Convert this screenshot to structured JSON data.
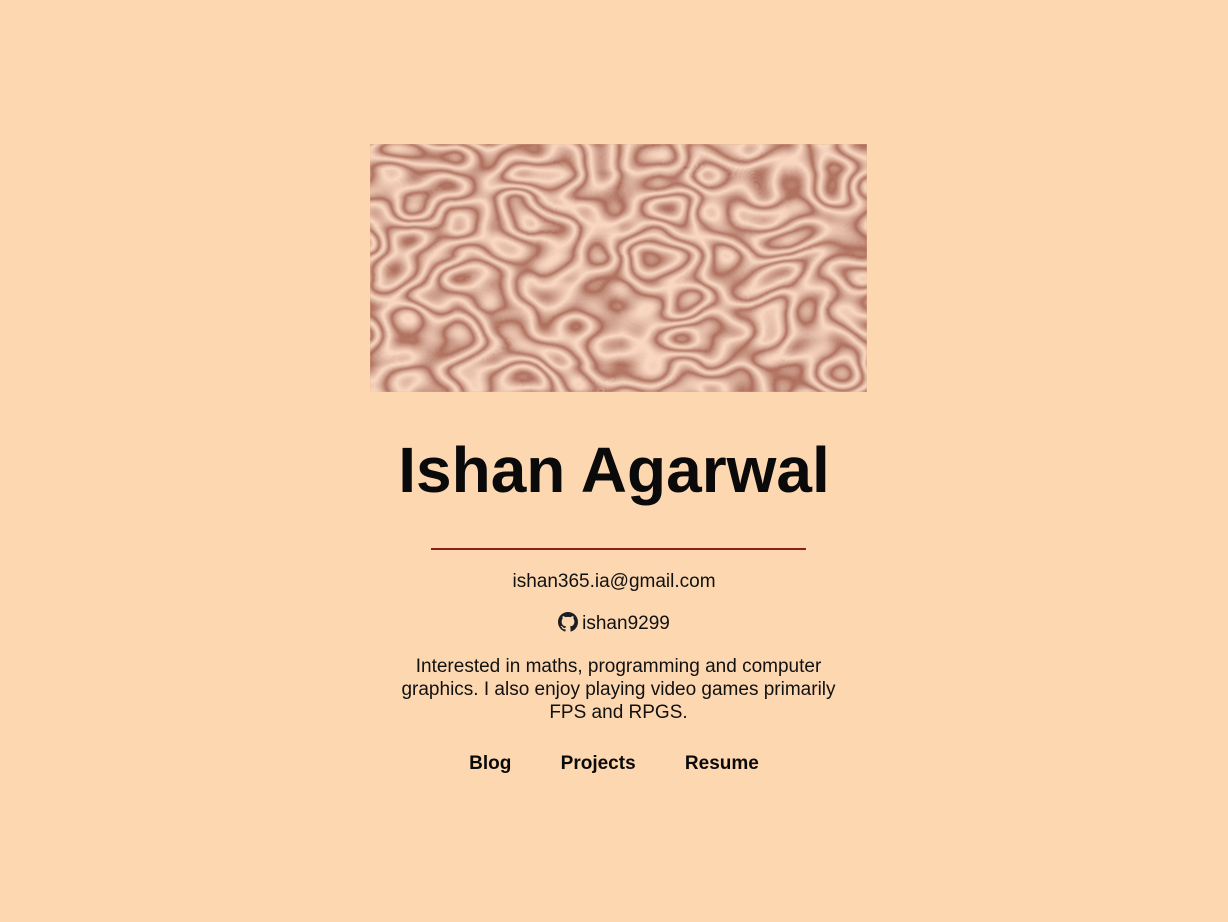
{
  "profile": {
    "name": "Ishan Agarwal",
    "email": "ishan365.ia@gmail.com",
    "github_username": "ishan9299",
    "bio": "Interested in maths, programming and computer graphics. I also enjoy playing video games primarily FPS and RPGS."
  },
  "nav": {
    "items": [
      {
        "label": "Blog"
      },
      {
        "label": "Projects"
      },
      {
        "label": "Resume"
      }
    ]
  },
  "icons": {
    "github": "github-icon"
  },
  "colors": {
    "background": "#fcd7b0",
    "rule": "#8a1f1a",
    "text": "#0a0a0a",
    "pattern_dark": "#7a2e22",
    "pattern_light": "#f3c98e"
  }
}
